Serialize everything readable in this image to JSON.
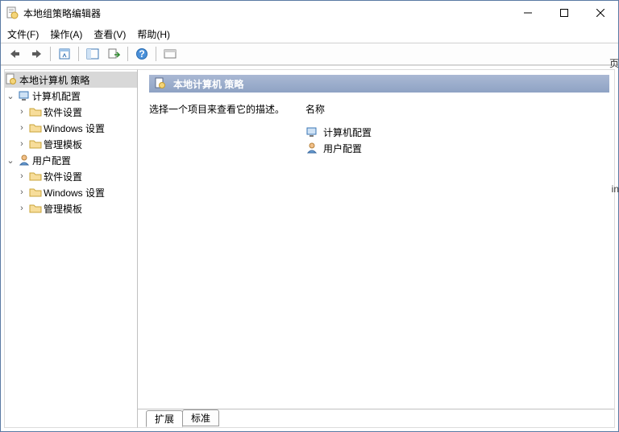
{
  "window": {
    "title": "本地组策略编辑器"
  },
  "menu": {
    "file": "文件(F)",
    "action": "操作(A)",
    "view": "查看(V)",
    "help": "帮助(H)"
  },
  "tree": {
    "root": "本地计算机 策略",
    "comp": "计算机配置",
    "comp_soft": "软件设置",
    "comp_win": "Windows 设置",
    "comp_adm": "管理模板",
    "user": "用户配置",
    "user_soft": "软件设置",
    "user_win": "Windows 设置",
    "user_adm": "管理模板"
  },
  "right": {
    "heading": "本地计算机 策略",
    "desc": "选择一个项目来查看它的描述。",
    "col_name": "名称",
    "item_comp": "计算机配置",
    "item_user": "用户配置"
  },
  "tabs": {
    "extended": "扩展",
    "standard": "标准"
  },
  "side": {
    "ch1": "页",
    "ch2": "in"
  }
}
